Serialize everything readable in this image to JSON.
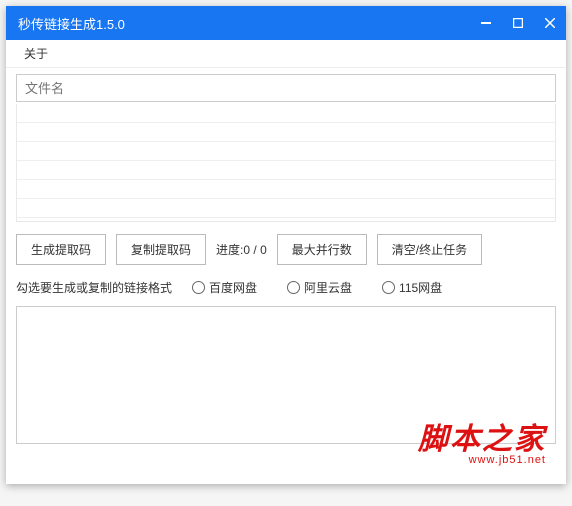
{
  "window": {
    "title": "秒传链接生成1.5.0"
  },
  "menu": {
    "about": "关于"
  },
  "input": {
    "placeholder": "文件名"
  },
  "buttons": {
    "generate": "生成提取码",
    "copy": "复制提取码",
    "maxParallel": "最大并行数",
    "clearStop": "清空/终止任务"
  },
  "progress": {
    "label": "进度:",
    "current": "0",
    "separator": " / ",
    "total": "0"
  },
  "format": {
    "label": "勾选要生成或复制的链接格式",
    "options": {
      "baidu": "百度网盘",
      "aliyun": "阿里云盘",
      "disk115": "115网盘"
    }
  },
  "watermark": {
    "main": "脚本之家",
    "sub": "www.jb51.net"
  }
}
